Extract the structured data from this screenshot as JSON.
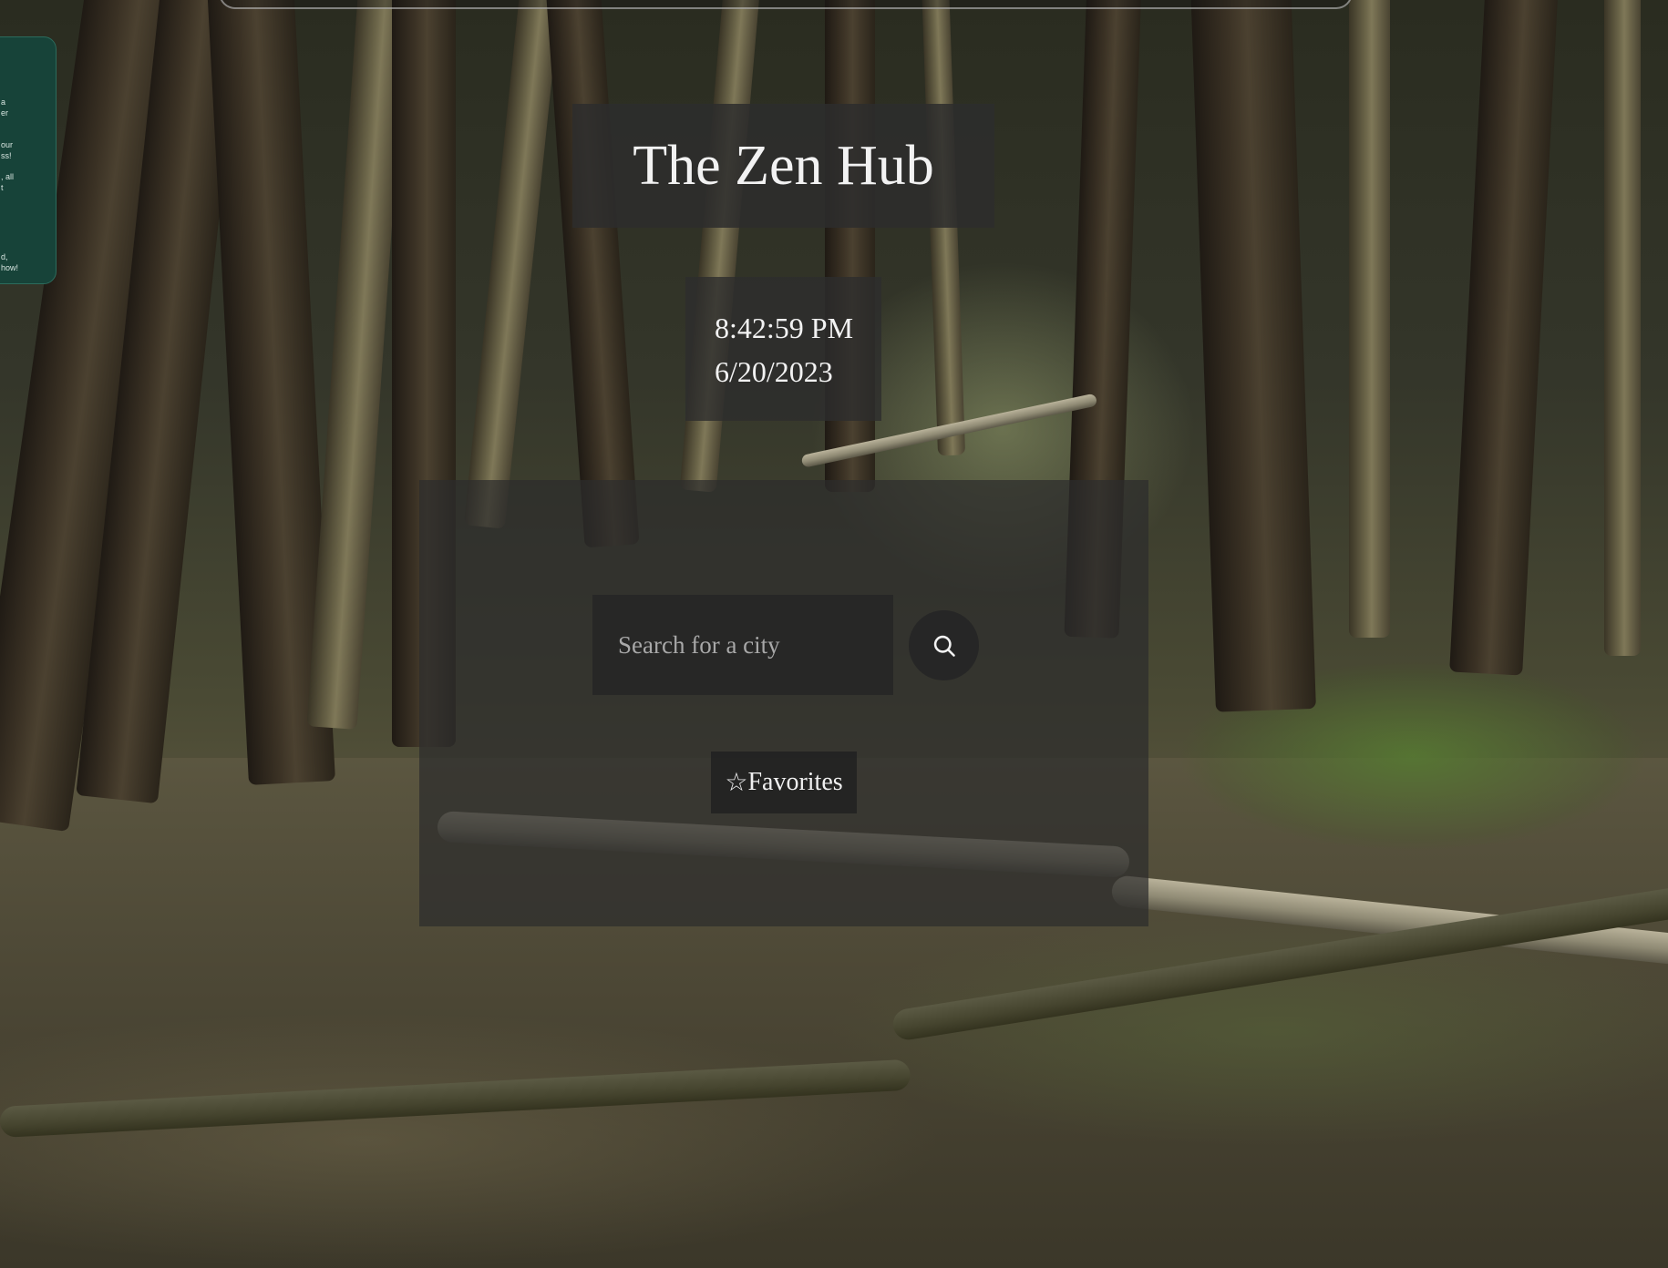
{
  "app": {
    "title": "The Zen Hub"
  },
  "clock": {
    "time": "8:42:59 PM",
    "date": "6/20/2023"
  },
  "search": {
    "placeholder": "Search for a city",
    "value": ""
  },
  "favorites": {
    "icon": "☆",
    "label": "Favorites"
  },
  "side_card": {
    "lines": [
      "a",
      "er",
      "our",
      "ss!",
      ", all",
      "t",
      "",
      "d,",
      "how!"
    ]
  },
  "colors": {
    "panel": "#2d2d2d",
    "side_card": "#174339",
    "text": "#f2f2f2",
    "placeholder": "#a8a8a8"
  },
  "icons": {
    "search_button": "search-icon",
    "favorites": "star-outline-icon"
  }
}
